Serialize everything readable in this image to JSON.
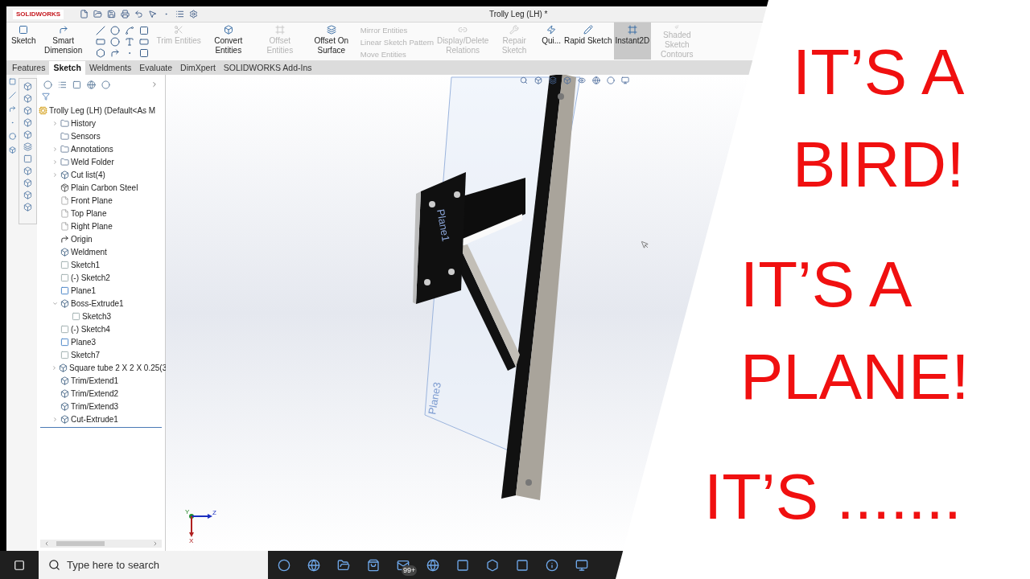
{
  "app": {
    "logo": "SOLIDWORKS",
    "title": "Trolly Leg (LH) *"
  },
  "ribbon": [
    {
      "kind": "large",
      "label": "Sketch",
      "disabled": false,
      "selected": false
    },
    {
      "kind": "large",
      "label": "Smart Dimension",
      "disabled": false,
      "selected": false
    },
    {
      "kind": "tools"
    },
    {
      "kind": "large",
      "label": "Trim Entities",
      "disabled": true,
      "selected": false
    },
    {
      "kind": "large",
      "label": "Convert Entities",
      "disabled": false,
      "selected": false
    },
    {
      "kind": "large",
      "label": "Offset Entities",
      "disabled": true,
      "selected": false
    },
    {
      "kind": "large",
      "label": "Offset On Surface",
      "disabled": false,
      "selected": false
    },
    {
      "kind": "stack",
      "items": [
        {
          "label": "Mirror Entities",
          "disabled": true
        },
        {
          "label": "Linear Sketch Pattern",
          "disabled": true
        },
        {
          "label": "Move Entities",
          "disabled": true
        }
      ]
    },
    {
      "kind": "large",
      "label": "Display/Delete Relations",
      "disabled": true,
      "selected": false
    },
    {
      "kind": "large",
      "label": "Repair Sketch",
      "disabled": true,
      "selected": false
    },
    {
      "kind": "large",
      "label": "Qui...",
      "disabled": false,
      "selected": false
    },
    {
      "kind": "large",
      "label": "Rapid Sketch",
      "disabled": false,
      "selected": false
    },
    {
      "kind": "large",
      "label": "Instant2D",
      "disabled": false,
      "selected": true
    },
    {
      "kind": "large",
      "label": "Shaded Sketch Contours",
      "disabled": true,
      "selected": false
    }
  ],
  "tabs": [
    {
      "label": "Features",
      "selected": false
    },
    {
      "label": "Sketch",
      "selected": true
    },
    {
      "label": "Weldments",
      "selected": false
    },
    {
      "label": "Evaluate",
      "selected": false
    },
    {
      "label": "DimXpert",
      "selected": false
    },
    {
      "label": "SOLIDWORKS Add-Ins",
      "selected": false
    }
  ],
  "tree": {
    "root": "Trolly Leg (LH)  (Default<As M",
    "items": [
      {
        "label": "History",
        "kind": "folder",
        "expanded": false
      },
      {
        "label": "Sensors",
        "kind": "folder"
      },
      {
        "label": "Annotations",
        "kind": "folder",
        "expanded": false
      },
      {
        "label": "Weld Folder",
        "kind": "folder",
        "expanded": false
      },
      {
        "label": "Cut list(4)",
        "kind": "feature",
        "expanded": false
      },
      {
        "label": "Plain Carbon Steel",
        "kind": "material"
      },
      {
        "label": "Front Plane",
        "kind": "plane"
      },
      {
        "label": "Top Plane",
        "kind": "plane"
      },
      {
        "label": "Right Plane",
        "kind": "plane"
      },
      {
        "label": "Origin",
        "kind": "origin"
      },
      {
        "label": "Weldment",
        "kind": "feature"
      },
      {
        "label": "Sketch1",
        "kind": "sketch"
      },
      {
        "label": "(-) Sketch2",
        "kind": "sketch"
      },
      {
        "label": "Plane1",
        "kind": "solid-plane"
      },
      {
        "label": "Boss-Extrude1",
        "kind": "feature",
        "expanded": true,
        "children": [
          {
            "label": "Sketch3",
            "kind": "sketch"
          }
        ]
      },
      {
        "label": "(-) Sketch4",
        "kind": "sketch"
      },
      {
        "label": "Plane3",
        "kind": "solid-plane"
      },
      {
        "label": "Sketch7",
        "kind": "sketch"
      },
      {
        "label": "Square tube 2 X 2 X 0.25(3",
        "kind": "feature",
        "expanded": false
      },
      {
        "label": "Trim/Extend1",
        "kind": "feature"
      },
      {
        "label": "Trim/Extend2",
        "kind": "feature"
      },
      {
        "label": "Trim/Extend3",
        "kind": "feature"
      },
      {
        "label": "Cut-Extrude1",
        "kind": "feature",
        "expanded": false
      }
    ]
  },
  "viewport": {
    "plane_labels": [
      "Plane3",
      "Plane1"
    ],
    "triad_labels": [
      "Y",
      "Z",
      "X"
    ]
  },
  "taskbar": {
    "search": {
      "placeholder": "Type here to search"
    },
    "mail_badge": "99+"
  },
  "headlines": [
    "IT’S A BIRD!",
    "IT’S A PLANE!",
    "IT’S ......."
  ]
}
